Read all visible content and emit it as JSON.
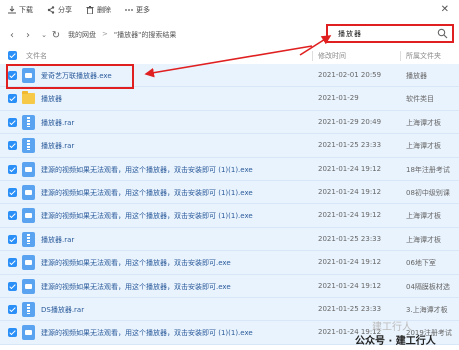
{
  "toolbar": {
    "download": "下载",
    "share": "分享",
    "delete": "删除",
    "more": "更多",
    "close": "✕"
  },
  "breadcrumb": {
    "root": "我的网盘",
    "sep": ">",
    "current": "\"播放器\"的搜索结果"
  },
  "search": {
    "value": "播放器",
    "placeholder": ""
  },
  "columns": {
    "name": "文件名",
    "date": "修改时间",
    "location": "所属文件夹"
  },
  "rows": [
    {
      "name": "爱奇艺万联播放器.exe",
      "date": "2021-02-01 20:59",
      "location": "播放器",
      "type": "exe"
    },
    {
      "name": "播放器",
      "date": "2021-01-29",
      "location": "软件类目",
      "type": "folder"
    },
    {
      "name": "播放器.rar",
      "date": "2021-01-29 20:49",
      "location": "上海谭才板",
      "type": "rar"
    },
    {
      "name": "播放器.rar",
      "date": "2021-01-25 23:33",
      "location": "上海谭才板",
      "type": "rar"
    },
    {
      "name": "建源的视频如果无法观看，用这个播放器，双击安装即可 (1)(1).exe",
      "date": "2021-01-24 19:12",
      "location": "18年注册考试",
      "type": "exe"
    },
    {
      "name": "建源的视频如果无法观看，用这个播放器，双击安装即可 (1)(1).exe",
      "date": "2021-01-24 19:12",
      "location": "08初中级别课",
      "type": "exe"
    },
    {
      "name": "建源的视频如果无法观看，用这个播放器，双击安装即可 (1)(1).exe",
      "date": "2021-01-24 19:12",
      "location": "上海谭才板",
      "type": "exe"
    },
    {
      "name": "播放器.rar",
      "date": "2021-01-25 23:33",
      "location": "上海谭才板",
      "type": "rar"
    },
    {
      "name": "建源的视频如果无法观看，用这个播放器，双击安装即可.exe",
      "date": "2021-01-24 19:12",
      "location": "06地下室",
      "type": "exe"
    },
    {
      "name": "建源的视频如果无法观看，用这个播放器，双击安装即可.exe",
      "date": "2021-01-24 19:12",
      "location": "04隔膜板材选",
      "type": "exe"
    },
    {
      "name": "DS播放器.rar",
      "date": "2021-01-25 23:33",
      "location": "3.上海谭才板",
      "type": "rar"
    },
    {
      "name": "建源的视频如果无法观看，用这个播放器，双击安装即可 (1)(1).exe",
      "date": "2021-01-24 19:12",
      "location": "2019注册考试",
      "type": "exe"
    }
  ],
  "watermark": "公众号 · 建工行人",
  "watermark_faint": "建工行人",
  "colors": {
    "highlight": "#e02020",
    "checkbox": "#2a8ff7",
    "row_bg": "#e9f3fd"
  }
}
